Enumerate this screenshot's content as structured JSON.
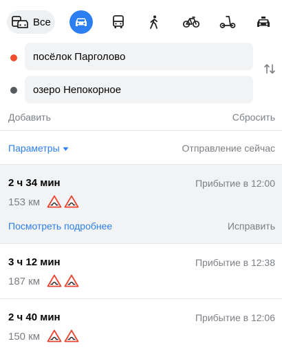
{
  "modes": {
    "all_label": "Все",
    "items": [
      {
        "name": "all",
        "icon": "car-and-bus-icon"
      },
      {
        "name": "car",
        "icon": "car-icon",
        "active": true
      },
      {
        "name": "bus",
        "icon": "bus-icon"
      },
      {
        "name": "walk",
        "icon": "pedestrian-icon"
      },
      {
        "name": "bike",
        "icon": "bicycle-icon"
      },
      {
        "name": "scooter",
        "icon": "scooter-icon"
      },
      {
        "name": "taxi",
        "icon": "taxi-icon"
      }
    ]
  },
  "waypoints": {
    "from": "посёлок Парголово",
    "to": "озеро Непокорное",
    "add_label": "Добавить",
    "reset_label": "Сбросить"
  },
  "params": {
    "label": "Параметры",
    "departure": "Отправление сейчас"
  },
  "routes": [
    {
      "time": "2 ч 34 мин",
      "arrival": "Прибытие в 12:00",
      "distance": "153 км",
      "more": "Посмотреть подробнее",
      "fix": "Исправить"
    },
    {
      "time": "3 ч 12 мин",
      "arrival": "Прибытие в 12:38",
      "distance": "187 км"
    },
    {
      "time": "2 ч 40 мин",
      "arrival": "Прибытие в 12:06",
      "distance": "150 км"
    }
  ],
  "colors": {
    "accent": "#2c7ff0",
    "origin_dot": "#f04d2e",
    "destination_dot": "#555a5f",
    "warning": "#e8432d"
  }
}
